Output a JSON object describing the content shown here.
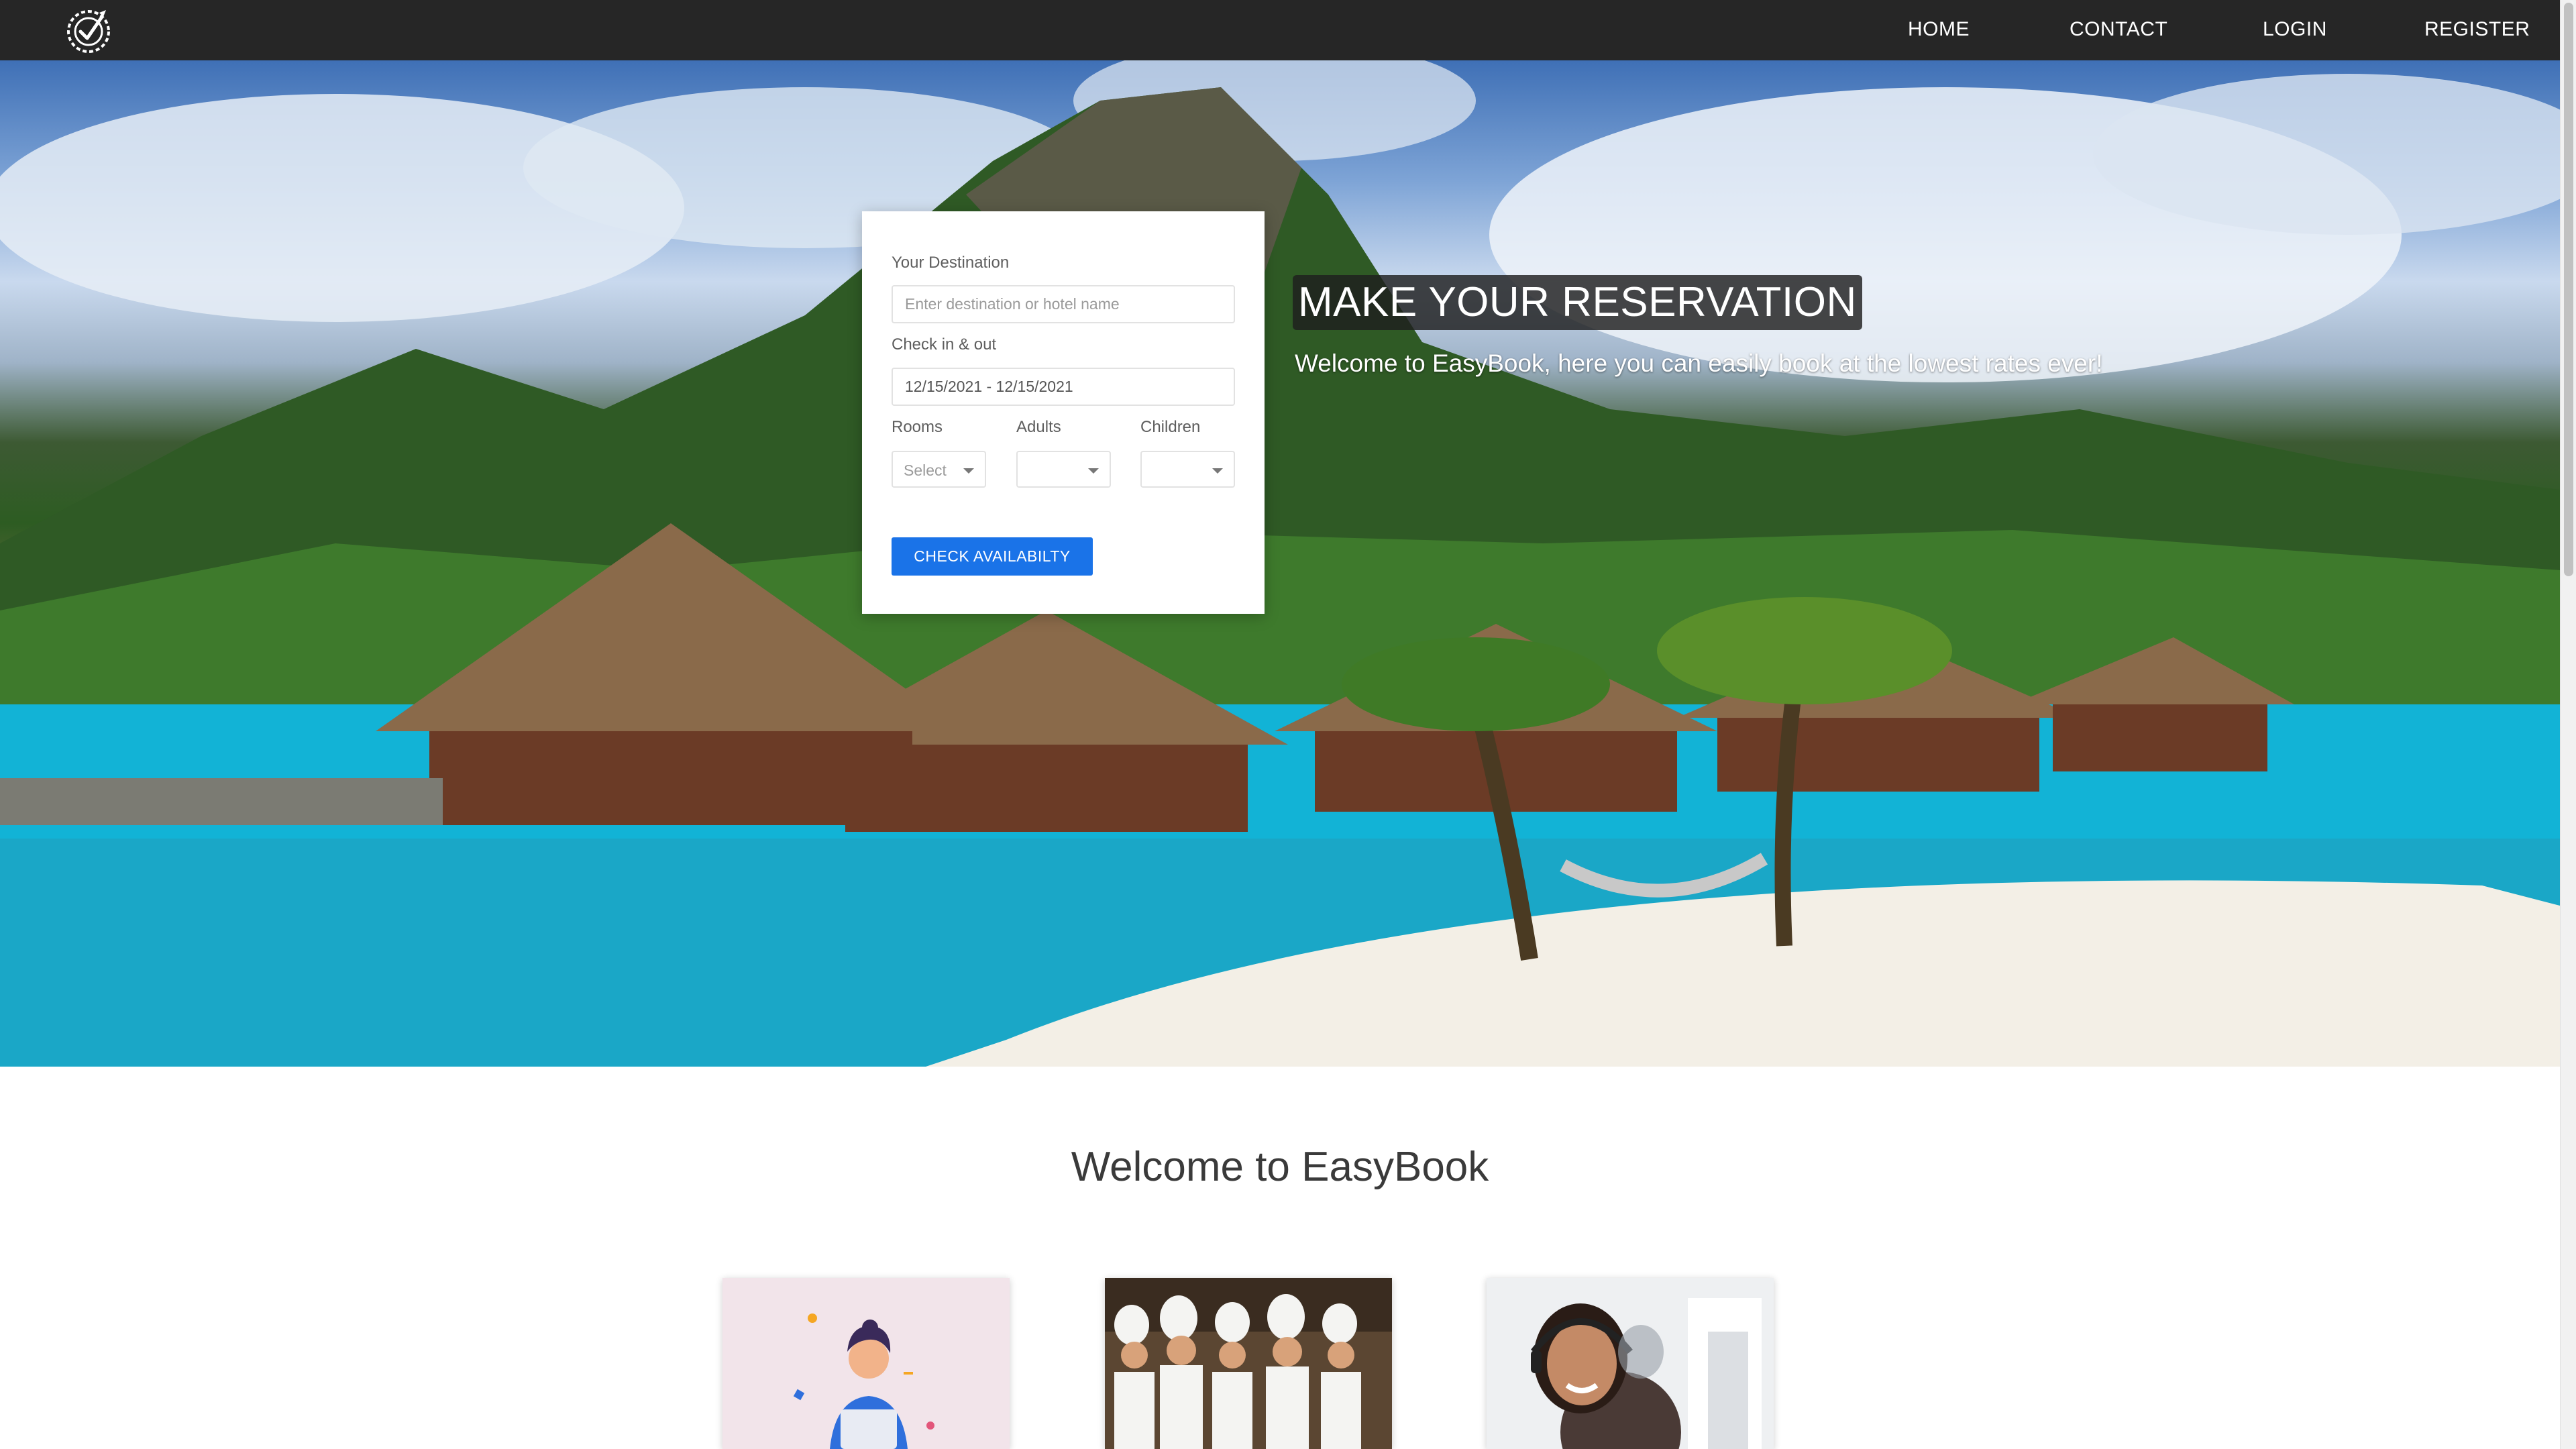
{
  "nav": {
    "home": "HOME",
    "contact": "CONTACT",
    "login": "LOGIN",
    "register": "REGISTER"
  },
  "booking": {
    "destination_label": "Your Destination",
    "destination_placeholder": "Enter destination or hotel name",
    "dates_label": "Check in & out",
    "dates_value": "12/15/2021 - 12/15/2021",
    "rooms_label": "Rooms",
    "rooms_value": "Select",
    "adults_label": "Adults",
    "adults_value": "",
    "children_label": "Children",
    "children_value": "",
    "check_button": "CHECK AVAILABILTY"
  },
  "hero": {
    "title": "MAKE YOUR RESERVATION",
    "subtitle": "Welcome to EasyBook, here you can easily book at the lowest rates ever!"
  },
  "welcome": {
    "title": "Welcome to EasyBook"
  },
  "colors": {
    "navbar": "#262626",
    "accent_button": "#1a73e8"
  }
}
